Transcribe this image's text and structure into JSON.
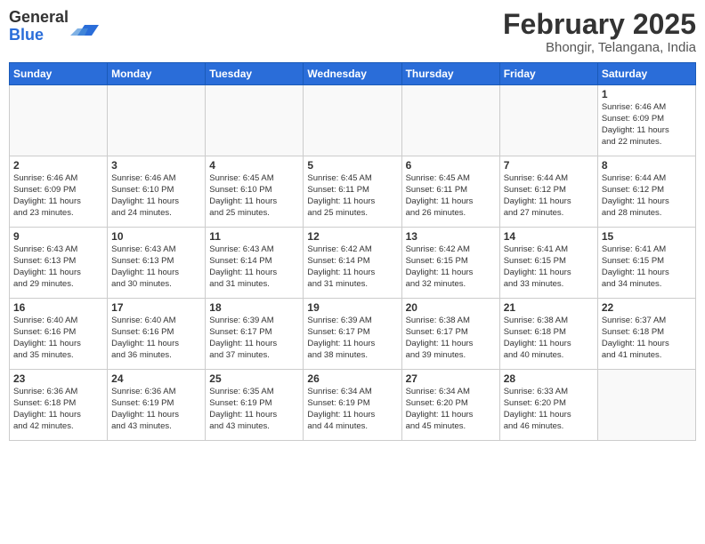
{
  "logo": {
    "general": "General",
    "blue": "Blue"
  },
  "title": "February 2025",
  "location": "Bhongir, Telangana, India",
  "days_of_week": [
    "Sunday",
    "Monday",
    "Tuesday",
    "Wednesday",
    "Thursday",
    "Friday",
    "Saturday"
  ],
  "weeks": [
    [
      {
        "day": null,
        "info": null
      },
      {
        "day": null,
        "info": null
      },
      {
        "day": null,
        "info": null
      },
      {
        "day": null,
        "info": null
      },
      {
        "day": null,
        "info": null
      },
      {
        "day": null,
        "info": null
      },
      {
        "day": "1",
        "info": "Sunrise: 6:46 AM\nSunset: 6:09 PM\nDaylight: 11 hours\nand 22 minutes."
      }
    ],
    [
      {
        "day": "2",
        "info": "Sunrise: 6:46 AM\nSunset: 6:09 PM\nDaylight: 11 hours\nand 23 minutes."
      },
      {
        "day": "3",
        "info": "Sunrise: 6:46 AM\nSunset: 6:10 PM\nDaylight: 11 hours\nand 24 minutes."
      },
      {
        "day": "4",
        "info": "Sunrise: 6:45 AM\nSunset: 6:10 PM\nDaylight: 11 hours\nand 25 minutes."
      },
      {
        "day": "5",
        "info": "Sunrise: 6:45 AM\nSunset: 6:11 PM\nDaylight: 11 hours\nand 25 minutes."
      },
      {
        "day": "6",
        "info": "Sunrise: 6:45 AM\nSunset: 6:11 PM\nDaylight: 11 hours\nand 26 minutes."
      },
      {
        "day": "7",
        "info": "Sunrise: 6:44 AM\nSunset: 6:12 PM\nDaylight: 11 hours\nand 27 minutes."
      },
      {
        "day": "8",
        "info": "Sunrise: 6:44 AM\nSunset: 6:12 PM\nDaylight: 11 hours\nand 28 minutes."
      }
    ],
    [
      {
        "day": "9",
        "info": "Sunrise: 6:43 AM\nSunset: 6:13 PM\nDaylight: 11 hours\nand 29 minutes."
      },
      {
        "day": "10",
        "info": "Sunrise: 6:43 AM\nSunset: 6:13 PM\nDaylight: 11 hours\nand 30 minutes."
      },
      {
        "day": "11",
        "info": "Sunrise: 6:43 AM\nSunset: 6:14 PM\nDaylight: 11 hours\nand 31 minutes."
      },
      {
        "day": "12",
        "info": "Sunrise: 6:42 AM\nSunset: 6:14 PM\nDaylight: 11 hours\nand 31 minutes."
      },
      {
        "day": "13",
        "info": "Sunrise: 6:42 AM\nSunset: 6:15 PM\nDaylight: 11 hours\nand 32 minutes."
      },
      {
        "day": "14",
        "info": "Sunrise: 6:41 AM\nSunset: 6:15 PM\nDaylight: 11 hours\nand 33 minutes."
      },
      {
        "day": "15",
        "info": "Sunrise: 6:41 AM\nSunset: 6:15 PM\nDaylight: 11 hours\nand 34 minutes."
      }
    ],
    [
      {
        "day": "16",
        "info": "Sunrise: 6:40 AM\nSunset: 6:16 PM\nDaylight: 11 hours\nand 35 minutes."
      },
      {
        "day": "17",
        "info": "Sunrise: 6:40 AM\nSunset: 6:16 PM\nDaylight: 11 hours\nand 36 minutes."
      },
      {
        "day": "18",
        "info": "Sunrise: 6:39 AM\nSunset: 6:17 PM\nDaylight: 11 hours\nand 37 minutes."
      },
      {
        "day": "19",
        "info": "Sunrise: 6:39 AM\nSunset: 6:17 PM\nDaylight: 11 hours\nand 38 minutes."
      },
      {
        "day": "20",
        "info": "Sunrise: 6:38 AM\nSunset: 6:17 PM\nDaylight: 11 hours\nand 39 minutes."
      },
      {
        "day": "21",
        "info": "Sunrise: 6:38 AM\nSunset: 6:18 PM\nDaylight: 11 hours\nand 40 minutes."
      },
      {
        "day": "22",
        "info": "Sunrise: 6:37 AM\nSunset: 6:18 PM\nDaylight: 11 hours\nand 41 minutes."
      }
    ],
    [
      {
        "day": "23",
        "info": "Sunrise: 6:36 AM\nSunset: 6:18 PM\nDaylight: 11 hours\nand 42 minutes."
      },
      {
        "day": "24",
        "info": "Sunrise: 6:36 AM\nSunset: 6:19 PM\nDaylight: 11 hours\nand 43 minutes."
      },
      {
        "day": "25",
        "info": "Sunrise: 6:35 AM\nSunset: 6:19 PM\nDaylight: 11 hours\nand 43 minutes."
      },
      {
        "day": "26",
        "info": "Sunrise: 6:34 AM\nSunset: 6:19 PM\nDaylight: 11 hours\nand 44 minutes."
      },
      {
        "day": "27",
        "info": "Sunrise: 6:34 AM\nSunset: 6:20 PM\nDaylight: 11 hours\nand 45 minutes."
      },
      {
        "day": "28",
        "info": "Sunrise: 6:33 AM\nSunset: 6:20 PM\nDaylight: 11 hours\nand 46 minutes."
      },
      {
        "day": null,
        "info": null
      }
    ]
  ]
}
